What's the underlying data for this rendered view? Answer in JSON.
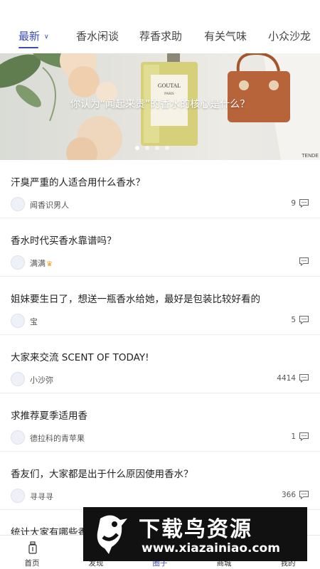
{
  "tabs": [
    {
      "label": "最新",
      "active": true
    },
    {
      "label": "香水闲谈"
    },
    {
      "label": "荐香求助"
    },
    {
      "label": "有关气味"
    },
    {
      "label": "小众沙龙"
    }
  ],
  "banner": {
    "caption": "你认为“闻起来贵”的香水的核心是什么？",
    "bottle_brand": "GOUTAL",
    "bottle_sub": "PARIS",
    "corner_text": "TENDE",
    "slides": 4,
    "active_slide": 1
  },
  "posts": [
    {
      "title": "汗臭严重的人适合用什么香水？",
      "author": "闻香识男人",
      "count": "9"
    },
    {
      "title": "香水时代买香水靠谱吗？",
      "author": "满满",
      "crown": true,
      "count": ""
    },
    {
      "title": "姐妹要生日了，想送一瓶香水给她，最好是包装比较好看的",
      "author": "宝",
      "count": "5"
    },
    {
      "title": "大家来交流 SCENT OF TODAY!",
      "author": "小沙弥",
      "count": "4414"
    },
    {
      "title": "求推荐夏季适用香",
      "author": "德拉科的青苹果",
      "count": "1"
    },
    {
      "title": "香友们，大家都是出于什么原因使用香水？",
      "author": "寻寻寻",
      "count": "366"
    },
    {
      "title": "统计大家有哪些香",
      "author": "",
      "count": ""
    }
  ],
  "bottom_nav": [
    {
      "label": "首页",
      "icon": "perfume-bottle-icon"
    },
    {
      "label": "发现",
      "icon": "discover-icon"
    },
    {
      "label": "圈子",
      "icon": "circle-icon",
      "active": true
    },
    {
      "label": "商城",
      "icon": "shop-icon"
    },
    {
      "label": "我的",
      "icon": "profile-icon"
    }
  ],
  "watermark": {
    "title": "下载鸟资源",
    "url": "www.xiazainiao.com"
  },
  "colors": {
    "accent": "#3d4bb0",
    "divider": "#ececec",
    "watermark_bg": "#111111"
  }
}
